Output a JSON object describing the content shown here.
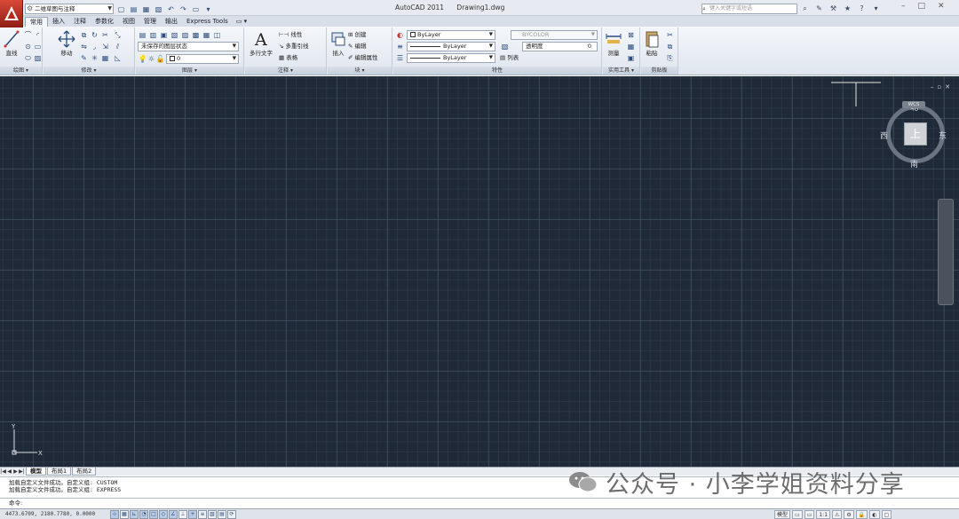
{
  "titlebar": {
    "workspace": "二维草图与注释",
    "app_name": "AutoCAD 2011",
    "drawing_name": "Drawing1.dwg",
    "search_placeholder": "键入关键字或短语",
    "qat_icons": [
      "new-icon",
      "open-icon",
      "save-icon",
      "undo-icon",
      "redo-icon",
      "plot-icon"
    ],
    "win_min": "–",
    "win_max": "□",
    "win_close": "✕"
  },
  "ribbon_tabs": [
    "常用",
    "插入",
    "注释",
    "参数化",
    "视图",
    "管理",
    "输出",
    "Express Tools"
  ],
  "ribbon_tab_extra": "▭ ▾",
  "panels": {
    "draw": {
      "title": "绘图 ▾",
      "line": "直线"
    },
    "modify": {
      "title": "修改 ▾",
      "move": "移动"
    },
    "layers": {
      "title": "图层 ▾",
      "layer_state": "未保存的图层状态",
      "current_layer": "0"
    },
    "annotation": {
      "title": "注释 ▾",
      "mtext": "多行文字",
      "dim_linear": "线性",
      "multileader": "多重引线",
      "table": "表格"
    },
    "block": {
      "title": "块 ▾",
      "insert": "插入",
      "create": "创建",
      "edit": "编辑",
      "edit_attr": "编辑属性"
    },
    "properties": {
      "title": "特性",
      "color": "ByLayer",
      "linetype": "ByLayer",
      "lineweight": "ByLayer",
      "plotstyle": "BYCOLOR",
      "transparency_label": "透明度",
      "transparency_value": "0",
      "list": "列表"
    },
    "utilities": {
      "title": "实用工具 ▾",
      "measure": "测量"
    },
    "clipboard": {
      "title": "剪贴板",
      "paste": "粘贴"
    }
  },
  "viewcube": {
    "north": "北",
    "south": "南",
    "west": "西",
    "east": "东",
    "face": "上",
    "wcs": "WCS"
  },
  "drawing_controls": [
    "–",
    "▫",
    "✕"
  ],
  "ucs": {
    "y": "Y",
    "x": "X"
  },
  "layout_tabs": {
    "nav": [
      "|◀",
      "◀",
      "▶",
      "▶|"
    ],
    "tabs": [
      "模型",
      "布局1",
      "布局2"
    ],
    "active": "模型"
  },
  "command": {
    "history": [
      "加载自定义文件成功。自定义组: CUSTOM",
      "加载自定义文件成功。自定义组: EXPRESS"
    ],
    "prompt": "命令:"
  },
  "watermark": "公众号 · 小李学姐资料分享",
  "status": {
    "coords": "4473.6709, 2180.7780, 0.0000",
    "model": "模型",
    "scale": "1:1"
  }
}
